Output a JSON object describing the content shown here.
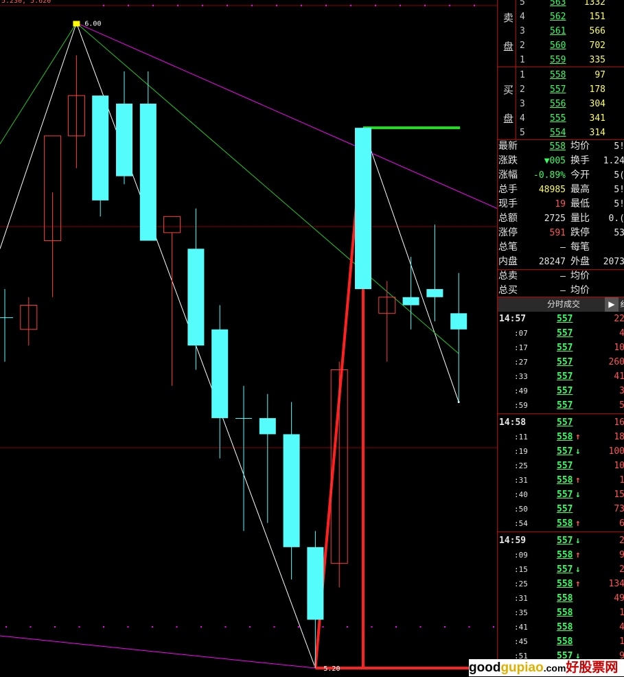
{
  "chart_data": {
    "type": "candlestick",
    "ylim": [
      5.2,
      6.02
    ],
    "top_label_left": "5.230, 5.620",
    "high_label": "6.00",
    "low_label": "5.20",
    "candles": [
      {
        "o": 5.635,
        "h": 5.67,
        "l": 5.58,
        "c": 5.635
      },
      {
        "o": 5.62,
        "h": 5.66,
        "l": 5.6,
        "c": 5.65
      },
      {
        "o": 5.73,
        "h": 5.79,
        "l": 5.66,
        "c": 5.86
      },
      {
        "o": 5.86,
        "h": 5.96,
        "l": 5.82,
        "c": 5.91
      },
      {
        "o": 5.91,
        "h": 5.91,
        "l": 5.76,
        "c": 5.78
      },
      {
        "o": 5.9,
        "h": 5.94,
        "l": 5.8,
        "c": 5.81
      },
      {
        "o": 5.9,
        "h": 5.94,
        "l": 5.79,
        "c": 5.73
      },
      {
        "o": 5.74,
        "h": 5.74,
        "l": 5.55,
        "c": 5.76
      },
      {
        "o": 5.72,
        "h": 5.77,
        "l": 5.57,
        "c": 5.6
      },
      {
        "o": 5.62,
        "h": 5.65,
        "l": 5.46,
        "c": 5.51
      },
      {
        "o": 5.51,
        "h": 5.55,
        "l": 5.37,
        "c": 5.51
      },
      {
        "o": 5.51,
        "h": 5.54,
        "l": 5.38,
        "c": 5.49
      },
      {
        "o": 5.49,
        "h": 5.53,
        "l": 5.31,
        "c": 5.35
      },
      {
        "o": 5.35,
        "h": 5.37,
        "l": 5.2,
        "c": 5.26
      },
      {
        "o": 5.33,
        "h": 5.58,
        "l": 5.3,
        "c": 5.57
      },
      {
        "o": 5.87,
        "h": 5.87,
        "l": 5.67,
        "c": 5.67
      },
      {
        "o": 5.64,
        "h": 5.68,
        "l": 5.58,
        "c": 5.66
      },
      {
        "o": 5.66,
        "h": 5.71,
        "l": 5.62,
        "c": 5.65
      },
      {
        "o": 5.67,
        "h": 5.75,
        "l": 5.63,
        "c": 5.66
      },
      {
        "o": 5.64,
        "h": 5.69,
        "l": 5.53,
        "c": 5.62
      }
    ]
  },
  "panel": {
    "sell_label": [
      "卖",
      "盘"
    ],
    "buy_label": [
      "买",
      "盘"
    ],
    "asks": [
      {
        "lvl": "5",
        "price": "563",
        "vol": "1332"
      },
      {
        "lvl": "4",
        "price": "562",
        "vol": "151"
      },
      {
        "lvl": "3",
        "price": "561",
        "vol": "566"
      },
      {
        "lvl": "2",
        "price": "560",
        "vol": "702"
      },
      {
        "lvl": "1",
        "price": "559",
        "vol": "335"
      }
    ],
    "bids": [
      {
        "lvl": "1",
        "price": "558",
        "vol": "97"
      },
      {
        "lvl": "2",
        "price": "557",
        "vol": "178"
      },
      {
        "lvl": "3",
        "price": "556",
        "vol": "304"
      },
      {
        "lvl": "4",
        "price": "555",
        "vol": "341"
      },
      {
        "lvl": "5",
        "price": "554",
        "vol": "314"
      }
    ],
    "stats": [
      {
        "l1": "最新",
        "v1": "558",
        "c1": "green",
        "l2": "均价",
        "v2": "5!"
      },
      {
        "l1": "涨跌",
        "v1": "▼005",
        "c1": "green",
        "l2": "换手",
        "v2": "1.24"
      },
      {
        "l1": "涨幅",
        "v1": "-0.89%",
        "c1": "green",
        "l2": "今开",
        "v2": "5("
      },
      {
        "l1": "总手",
        "v1": "48985",
        "c1": "yellow",
        "l2": "最高",
        "v2": "5!"
      },
      {
        "l1": "现手",
        "v1": "19",
        "c1": "red",
        "l2": "最低",
        "v2": "5!"
      },
      {
        "l1": "总额",
        "v1": "2725",
        "c1": "white",
        "l2": "量比",
        "v2": "0.("
      },
      {
        "l1": "涨停",
        "v1": "591",
        "c1": "red",
        "l2": "跌停",
        "v2": "53"
      },
      {
        "l1": "总笔",
        "v1": "–",
        "c1": "white",
        "l2": "每笔",
        "v2": ""
      },
      {
        "l1": "内盘",
        "v1": "28247",
        "c1": "white",
        "l2": "外盘",
        "v2": "2073"
      },
      {
        "l1": "总卖",
        "v1": "–",
        "c1": "white",
        "l2": "均价",
        "v2": ""
      },
      {
        "l1": "总买",
        "v1": "–",
        "c1": "white",
        "l2": "均价",
        "v2": ""
      }
    ],
    "trade_title": "分时成交",
    "trade_btn": "▶",
    "trade_more": "纟",
    "trades": [
      {
        "t": "14:57",
        "p": "557",
        "a": "",
        "v": "22"
      },
      {
        "t": ":07",
        "p": "557",
        "a": "",
        "v": "4"
      },
      {
        "t": ":17",
        "p": "557",
        "a": "",
        "v": "10"
      },
      {
        "t": ":27",
        "p": "557",
        "a": "",
        "v": "260"
      },
      {
        "t": ":33",
        "p": "557",
        "a": "",
        "v": "41"
      },
      {
        "t": ":49",
        "p": "557",
        "a": "",
        "v": "3"
      },
      {
        "t": ":59",
        "p": "557",
        "a": "",
        "v": "5"
      },
      {
        "t": "14:58",
        "p": "557",
        "a": "",
        "v": "16"
      },
      {
        "t": ":11",
        "p": "558",
        "a": "↑",
        "v": "18"
      },
      {
        "t": ":19",
        "p": "557",
        "a": "↓",
        "v": "100"
      },
      {
        "t": ":25",
        "p": "557",
        "a": "",
        "v": "10"
      },
      {
        "t": ":31",
        "p": "558",
        "a": "↑",
        "v": "1"
      },
      {
        "t": ":40",
        "p": "557",
        "a": "↓",
        "v": "15"
      },
      {
        "t": ":50",
        "p": "557",
        "a": "",
        "v": "73"
      },
      {
        "t": ":54",
        "p": "558",
        "a": "↑",
        "v": "6"
      },
      {
        "t": "14:59",
        "p": "557",
        "a": "↓",
        "v": "2"
      },
      {
        "t": ":09",
        "p": "558",
        "a": "↑",
        "v": "9"
      },
      {
        "t": ":15",
        "p": "557",
        "a": "↓",
        "v": "2"
      },
      {
        "t": ":25",
        "p": "558",
        "a": "↑",
        "v": "134"
      },
      {
        "t": ":31",
        "p": "558",
        "a": "",
        "v": "49"
      },
      {
        "t": ":35",
        "p": "558",
        "a": "",
        "v": "1"
      },
      {
        "t": ":41",
        "p": "558",
        "a": "",
        "v": "4"
      },
      {
        "t": ":45",
        "p": "558",
        "a": "",
        "v": "1"
      },
      {
        "t": ":51",
        "p": "557",
        "a": "↓",
        "v": "9"
      }
    ]
  },
  "watermark": {
    "p1": "good",
    "p2": "gupiao",
    "p3": ".com",
    "p4": "好股票网"
  },
  "colors": {
    "bg": "#000000",
    "up": "#ff3c3c",
    "down": "#54fcfc",
    "grid": "#8b0000",
    "accent_green": "#22cc22",
    "magenta": "#ff00ff"
  }
}
